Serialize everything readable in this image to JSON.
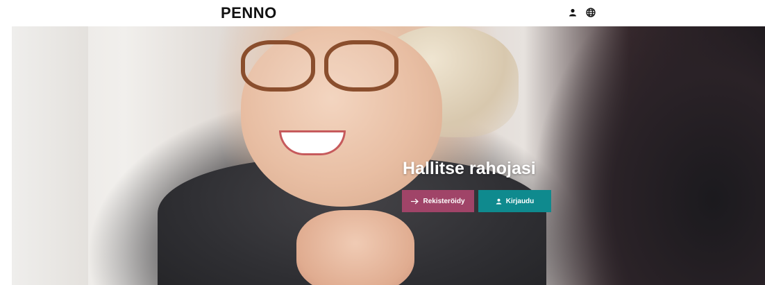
{
  "header": {
    "logo": "PENNO",
    "icons": [
      "user-icon",
      "globe-icon"
    ]
  },
  "hero": {
    "headline": "Hallitse rahojasi",
    "register_button": {
      "label": "Rekisteröidy",
      "icon": "arrow-right-icon",
      "color": "#a04468"
    },
    "login_button": {
      "label": "Kirjaudu",
      "icon": "user-icon",
      "color": "#0f8a8e"
    }
  }
}
